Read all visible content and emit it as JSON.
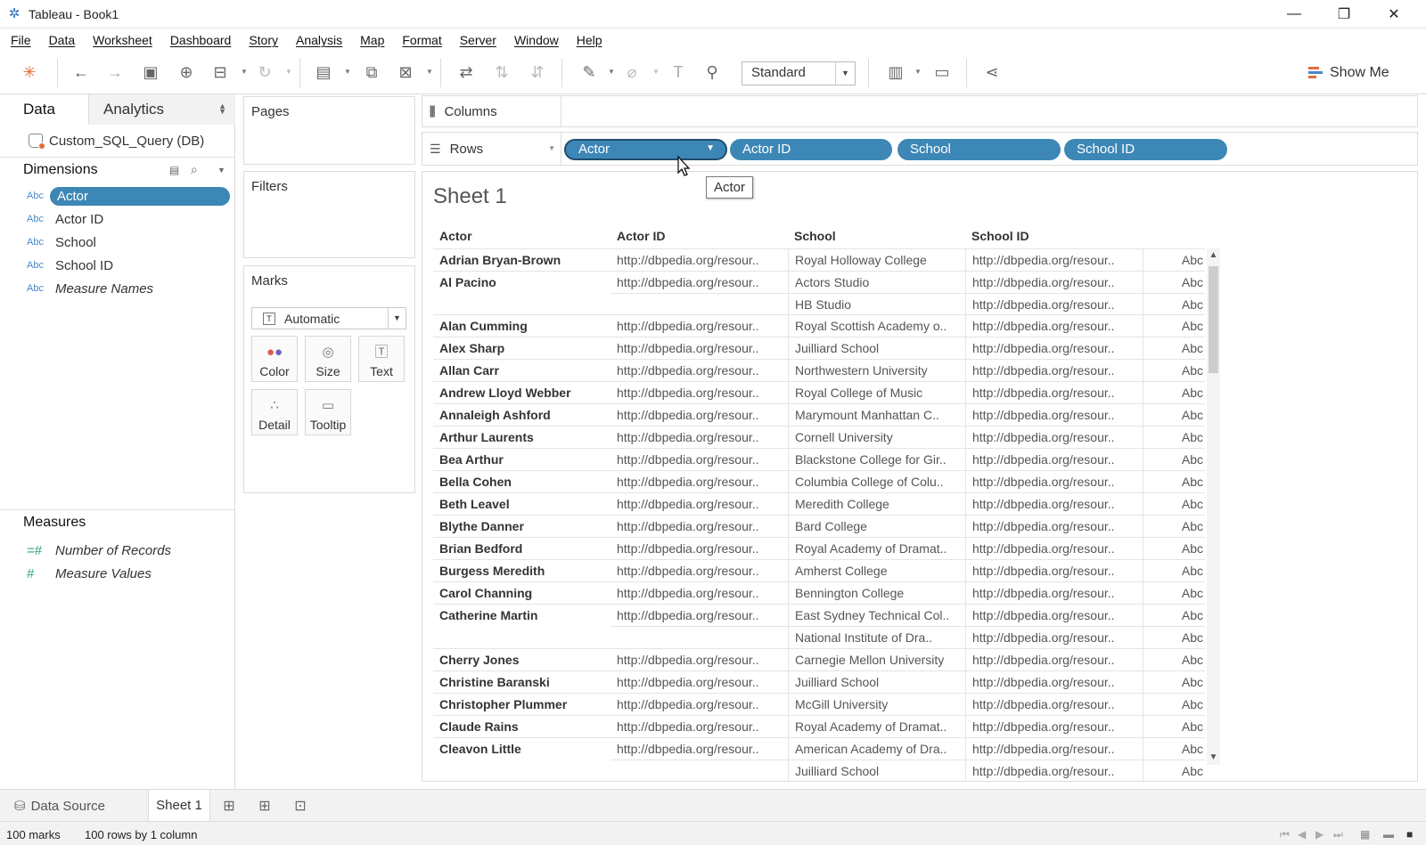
{
  "window": {
    "title": "Tableau - Book1",
    "minimize": "—",
    "restore": "❐",
    "close": "✕"
  },
  "menu": [
    "File",
    "Data",
    "Worksheet",
    "Dashboard",
    "Story",
    "Analysis",
    "Map",
    "Format",
    "Server",
    "Window",
    "Help"
  ],
  "toolbar": {
    "fit_value": "Standard",
    "show_me": "Show Me"
  },
  "data_pane": {
    "tab_data": "Data",
    "tab_analytics": "Analytics",
    "datasource": "Custom_SQL_Query (DB)",
    "dimensions_title": "Dimensions",
    "dimensions": [
      {
        "type": "Abc",
        "name": "Actor"
      },
      {
        "type": "Abc",
        "name": "Actor ID"
      },
      {
        "type": "Abc",
        "name": "School"
      },
      {
        "type": "Abc",
        "name": "School ID"
      },
      {
        "type": "Abc",
        "name": "Measure Names"
      }
    ],
    "measures_title": "Measures",
    "measures": [
      {
        "type": "=#",
        "name": "Number of Records"
      },
      {
        "type": "#",
        "name": "Measure Values"
      }
    ]
  },
  "cards": {
    "pages": "Pages",
    "filters": "Filters",
    "marks": "Marks",
    "mark_type": "Automatic",
    "buttons": [
      "Color",
      "Size",
      "Text",
      "Detail",
      "Tooltip"
    ]
  },
  "shelves": {
    "columns": "Columns",
    "rows": "Rows",
    "row_pills": [
      "Actor",
      "Actor ID",
      "School",
      "School ID"
    ]
  },
  "tooltip": "Actor",
  "sheet": {
    "title": "Sheet 1",
    "headers": [
      "Actor",
      "Actor ID",
      "School",
      "School ID"
    ],
    "rows": [
      [
        "Adrian Bryan-Brown",
        "http://dbpedia.org/resour..",
        "Royal Holloway College",
        "http://dbpedia.org/resour..",
        "Abc"
      ],
      [
        "Al Pacino",
        "http://dbpedia.org/resour..",
        "Actors Studio",
        "http://dbpedia.org/resour..",
        "Abc"
      ],
      [
        "",
        "",
        "HB Studio",
        "http://dbpedia.org/resour..",
        "Abc"
      ],
      [
        "Alan Cumming",
        "http://dbpedia.org/resour..",
        "Royal Scottish Academy o..",
        "http://dbpedia.org/resour..",
        "Abc"
      ],
      [
        "Alex Sharp",
        "http://dbpedia.org/resour..",
        "Juilliard School",
        "http://dbpedia.org/resour..",
        "Abc"
      ],
      [
        "Allan Carr",
        "http://dbpedia.org/resour..",
        "Northwestern University",
        "http://dbpedia.org/resour..",
        "Abc"
      ],
      [
        "Andrew Lloyd Webber",
        "http://dbpedia.org/resour..",
        "Royal College of Music",
        "http://dbpedia.org/resour..",
        "Abc"
      ],
      [
        "Annaleigh Ashford",
        "http://dbpedia.org/resour..",
        "Marymount Manhattan C..",
        "http://dbpedia.org/resour..",
        "Abc"
      ],
      [
        "Arthur Laurents",
        "http://dbpedia.org/resour..",
        "Cornell University",
        "http://dbpedia.org/resour..",
        "Abc"
      ],
      [
        "Bea Arthur",
        "http://dbpedia.org/resour..",
        "Blackstone College for Gir..",
        "http://dbpedia.org/resour..",
        "Abc"
      ],
      [
        "Bella Cohen",
        "http://dbpedia.org/resour..",
        "Columbia College of Colu..",
        "http://dbpedia.org/resour..",
        "Abc"
      ],
      [
        "Beth Leavel",
        "http://dbpedia.org/resour..",
        "Meredith College",
        "http://dbpedia.org/resour..",
        "Abc"
      ],
      [
        "Blythe Danner",
        "http://dbpedia.org/resour..",
        "Bard College",
        "http://dbpedia.org/resour..",
        "Abc"
      ],
      [
        "Brian Bedford",
        "http://dbpedia.org/resour..",
        "Royal Academy of Dramat..",
        "http://dbpedia.org/resour..",
        "Abc"
      ],
      [
        "Burgess Meredith",
        "http://dbpedia.org/resour..",
        "Amherst College",
        "http://dbpedia.org/resour..",
        "Abc"
      ],
      [
        "Carol Channing",
        "http://dbpedia.org/resour..",
        "Bennington College",
        "http://dbpedia.org/resour..",
        "Abc"
      ],
      [
        "Catherine Martin",
        "http://dbpedia.org/resour..",
        "East Sydney Technical Col..",
        "http://dbpedia.org/resour..",
        "Abc"
      ],
      [
        "",
        "",
        "National Institute of Dra..",
        "http://dbpedia.org/resour..",
        "Abc"
      ],
      [
        "Cherry Jones",
        "http://dbpedia.org/resour..",
        "Carnegie Mellon University",
        "http://dbpedia.org/resour..",
        "Abc"
      ],
      [
        "Christine Baranski",
        "http://dbpedia.org/resour..",
        "Juilliard School",
        "http://dbpedia.org/resour..",
        "Abc"
      ],
      [
        "Christopher Plummer",
        "http://dbpedia.org/resour..",
        "McGill University",
        "http://dbpedia.org/resour..",
        "Abc"
      ],
      [
        "Claude Rains",
        "http://dbpedia.org/resour..",
        "Royal Academy of Dramat..",
        "http://dbpedia.org/resour..",
        "Abc"
      ],
      [
        "Cleavon Little",
        "http://dbpedia.org/resour..",
        "American Academy of Dra..",
        "http://dbpedia.org/resour..",
        "Abc"
      ],
      [
        "",
        "",
        "Juilliard School",
        "http://dbpedia.org/resour..",
        "Abc"
      ]
    ]
  },
  "bottom_tabs": {
    "data_source": "Data Source",
    "sheet1": "Sheet 1"
  },
  "status": {
    "marks": "100 marks",
    "rows": "100 rows by 1 column"
  },
  "colors": {
    "pill": "#3d87b6",
    "dimension_icon": "#4a86c5",
    "measure_icon": "#2ea57a"
  }
}
